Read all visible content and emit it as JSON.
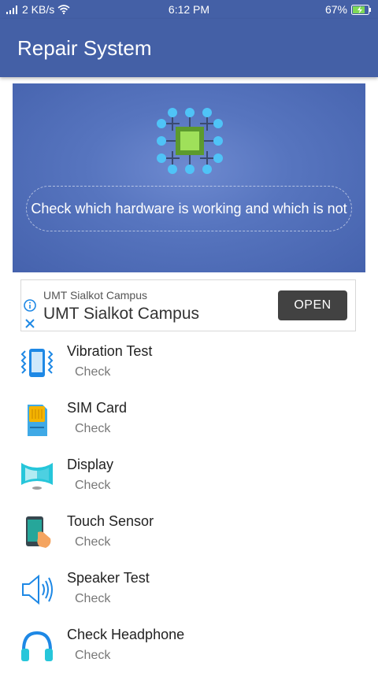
{
  "status_bar": {
    "network_speed": "2 KB/s",
    "time": "6:12 PM",
    "battery": "67%",
    "icons": [
      "signal-icon",
      "wifi-icon",
      "battery-charging-icon"
    ]
  },
  "app_bar": {
    "title": "Repair System"
  },
  "hero": {
    "message": "Check which hardware is working and which is not",
    "icon": "chip-icon"
  },
  "ad": {
    "small_title": "UMT Sialkot Campus",
    "big_title": "UMT Sialkot Campus",
    "open_label": "OPEN"
  },
  "tests": [
    {
      "label": "Vibration Test",
      "action": "Check",
      "icon": "vibration-icon"
    },
    {
      "label": "SIM Card",
      "action": "Check",
      "icon": "sim-card-icon"
    },
    {
      "label": "Display",
      "action": "Check",
      "icon": "display-icon"
    },
    {
      "label": "Touch Sensor",
      "action": "Check",
      "icon": "touch-icon"
    },
    {
      "label": "Speaker Test",
      "action": "Check",
      "icon": "speaker-icon"
    },
    {
      "label": "Check Headphone",
      "action": "Check",
      "icon": "headphone-icon"
    }
  ],
  "colors": {
    "primary": "#4460a6",
    "hero": "#5775bf",
    "chip_green": "#7ac943",
    "chip_dots": "#4fc3f7"
  }
}
